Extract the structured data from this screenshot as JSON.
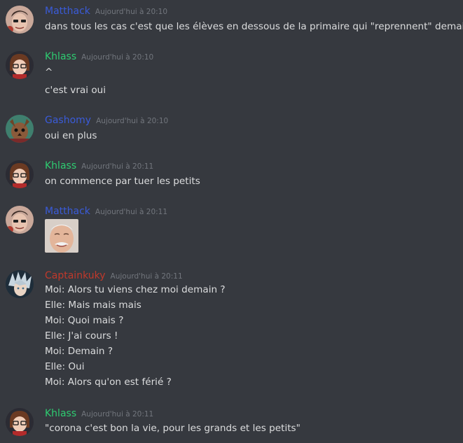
{
  "colors": {
    "background": "#36393f",
    "text": "#dcddde",
    "timestamp": "#72767d",
    "matthack": "#3a5bd9",
    "khlass": "#2ecc71",
    "gashomy": "#3a5bd9",
    "captainkuky": "#c0392b"
  },
  "messages": [
    {
      "author": "Matthack",
      "timestamp": "Aujourd'hui à 20:10",
      "lines": [
        "dans tous les cas c'est que les élèves en dessous de la primaire qui \"reprennent\" demain"
      ]
    },
    {
      "author": "Khlass",
      "timestamp": "Aujourd'hui à 20:10",
      "lines": [
        "^",
        "c'est vrai oui"
      ]
    },
    {
      "author": "Gashomy",
      "timestamp": "Aujourd'hui à 20:10",
      "lines": [
        "oui en plus"
      ]
    },
    {
      "author": "Khlass",
      "timestamp": "Aujourd'hui à 20:11",
      "lines": [
        "on commence par tuer les petits"
      ]
    },
    {
      "author": "Matthack",
      "timestamp": "Aujourd'hui à 20:11",
      "attachment": "image-harold-meme"
    },
    {
      "author": "Captainkuky",
      "timestamp": "Aujourd'hui à 20:11",
      "lines": [
        "Moi: Alors tu viens chez moi demain ?",
        "Elle: Mais mais mais",
        "Moi: Quoi mais ?",
        "Elle: J'ai cours !",
        "Moi: Demain ?",
        "Elle: Oui",
        "Moi: Alors qu'on est férié ?"
      ]
    },
    {
      "author": "Khlass",
      "timestamp": "Aujourd'hui à 20:11",
      "lines": [
        "\"corona c'est bon la vie, pour les grands et les petits\""
      ]
    }
  ]
}
